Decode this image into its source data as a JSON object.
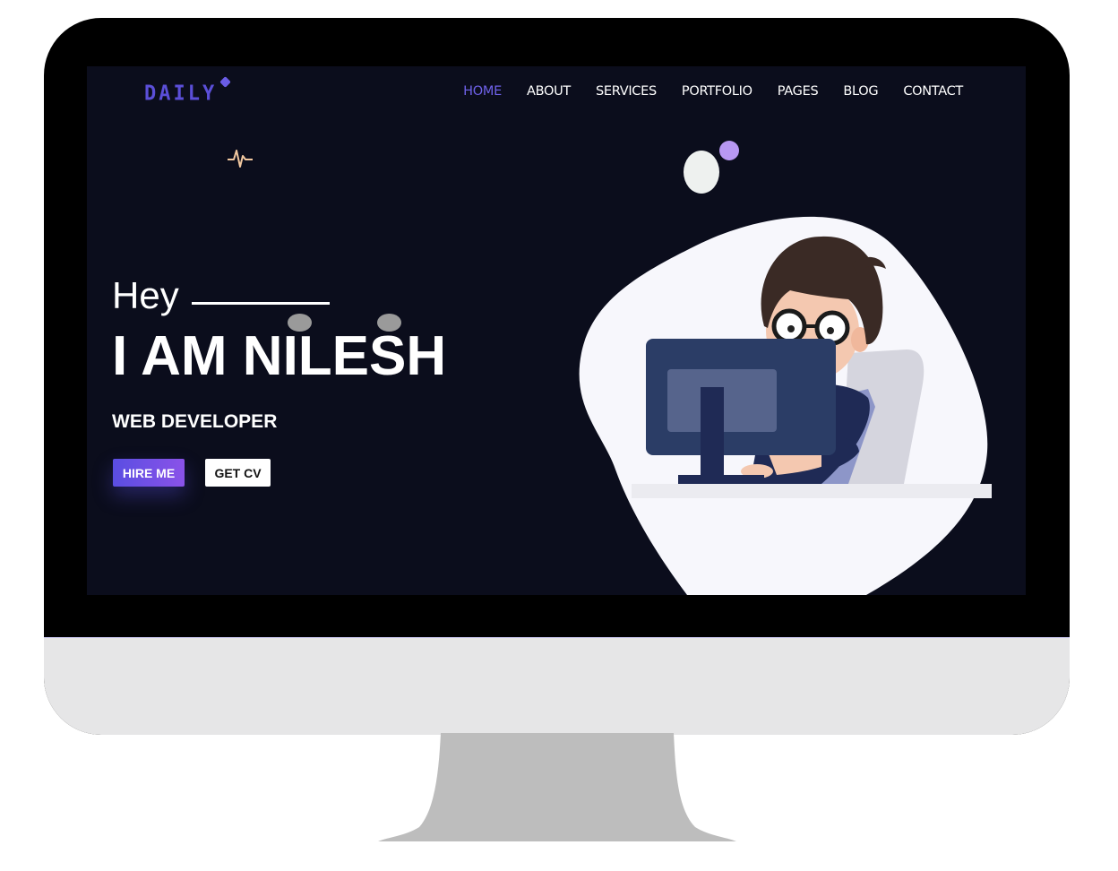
{
  "brand": {
    "logo_text": "DAILY"
  },
  "nav": {
    "items": [
      {
        "label": "HOME",
        "active": true
      },
      {
        "label": "ABOUT",
        "active": false
      },
      {
        "label": "SERVICES",
        "active": false
      },
      {
        "label": "PORTFOLIO",
        "active": false
      },
      {
        "label": "PAGES",
        "active": false
      },
      {
        "label": "BLOG",
        "active": false
      },
      {
        "label": "CONTACT",
        "active": false
      }
    ]
  },
  "hero": {
    "greeting": "Hey",
    "name": "I AM NILESH",
    "role": "WEB DEVELOPER",
    "hire_button": "HIRE ME",
    "cv_button": "GET CV"
  },
  "colors": {
    "accent": "#5b4fd8",
    "page_bg": "#0b0d1c",
    "pulse": "#f2c8a0"
  },
  "icons": [
    "pulse-icon",
    "logo-diamond-icon"
  ]
}
